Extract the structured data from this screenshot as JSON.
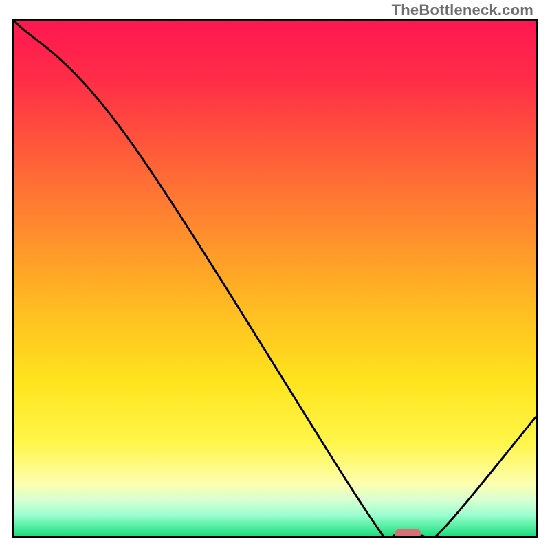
{
  "watermark": "TheBottleneck.com",
  "chart_data": {
    "type": "line",
    "title": "",
    "xlabel": "",
    "ylabel": "",
    "xlim": [
      0,
      100
    ],
    "ylim": [
      0,
      100
    ],
    "x": [
      0,
      22,
      68,
      73,
      78,
      82,
      100
    ],
    "values": [
      100,
      77,
      4,
      0,
      0,
      1,
      23
    ],
    "marker": {
      "x_start": 73,
      "x_end": 78,
      "y": 0,
      "color": "#d96f76"
    },
    "gradient_stops": [
      {
        "pos": 0.0,
        "color": "#ff1751"
      },
      {
        "pos": 0.12,
        "color": "#ff2f47"
      },
      {
        "pos": 0.25,
        "color": "#ff5a3a"
      },
      {
        "pos": 0.4,
        "color": "#ff8a2e"
      },
      {
        "pos": 0.55,
        "color": "#ffba22"
      },
      {
        "pos": 0.7,
        "color": "#ffe41e"
      },
      {
        "pos": 0.82,
        "color": "#fff64a"
      },
      {
        "pos": 0.9,
        "color": "#fdffb0"
      },
      {
        "pos": 0.93,
        "color": "#d9ffd0"
      },
      {
        "pos": 0.96,
        "color": "#9cffd0"
      },
      {
        "pos": 1.0,
        "color": "#1de07e"
      }
    ]
  }
}
